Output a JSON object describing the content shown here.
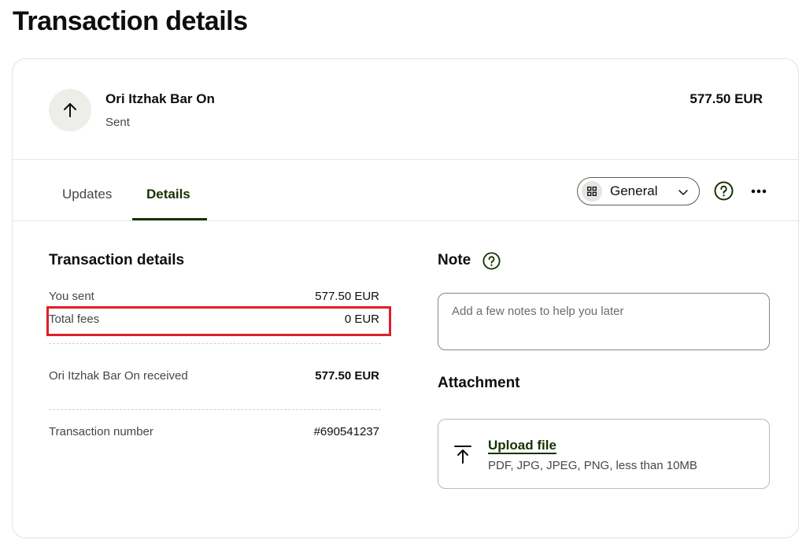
{
  "page": {
    "title": "Transaction details"
  },
  "header": {
    "recipient_name": "Ori Itzhak Bar On",
    "status": "Sent",
    "amount": "577.50 EUR",
    "avatar_icon": "arrow-up-icon"
  },
  "tabs": [
    {
      "label": "Updates",
      "active": false
    },
    {
      "label": "Details",
      "active": true
    }
  ],
  "category": {
    "icon": "grid-icon",
    "selected": "General"
  },
  "details": {
    "title": "Transaction details",
    "rows": [
      {
        "label": "You sent",
        "value": "577.50 EUR"
      },
      {
        "label": "Total fees",
        "value": "0 EUR",
        "highlighted": true
      },
      {
        "label": "Ori Itzhak Bar On received",
        "value": "577.50 EUR"
      },
      {
        "label": "Transaction number",
        "value": "#690541237"
      }
    ]
  },
  "note": {
    "title": "Note",
    "value": "",
    "placeholder": "Add a few notes to help you later"
  },
  "attachment": {
    "title": "Attachment",
    "upload_label": "Upload file",
    "hint": "PDF, JPG, JPEG, PNG, less than 10MB"
  },
  "colors": {
    "accent": "#163300",
    "highlight": "#e01f26",
    "text": "#0e0f0c",
    "muted": "#454745"
  }
}
